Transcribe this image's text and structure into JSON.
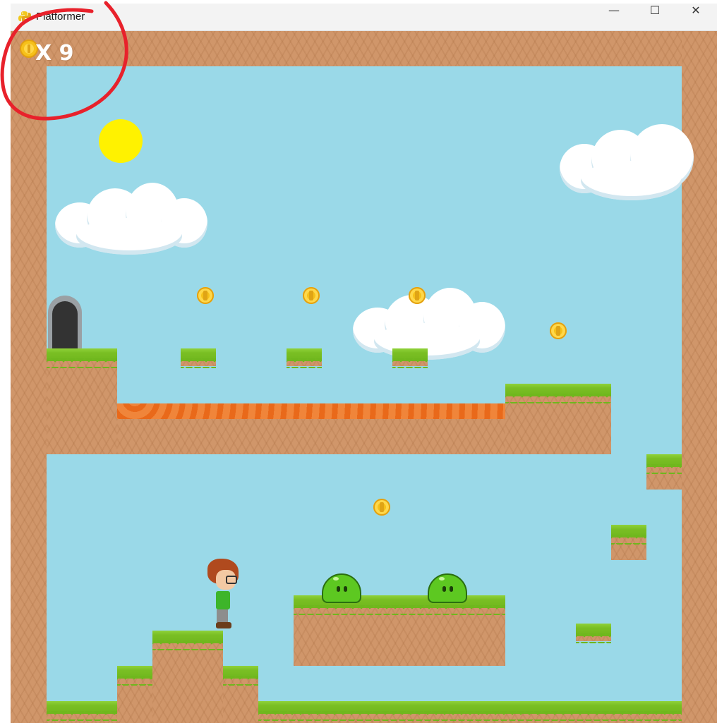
{
  "window": {
    "title": "Platformer",
    "minimize_glyph": "—",
    "maximize_glyph": "☐",
    "close_glyph": "✕"
  },
  "hud": {
    "coin_counter": "X 9"
  },
  "colors": {
    "sky": "#9ad9e8",
    "dirt": "#d0966a",
    "grass": "#7abf24",
    "lava": "#e9691a",
    "sun": "#fff200",
    "coin": "#f6c11a",
    "slime": "#5dc821",
    "annotation": "#e8212b"
  },
  "icons": {
    "app": "python-snake-icon",
    "hud_coin": "coin-icon"
  }
}
